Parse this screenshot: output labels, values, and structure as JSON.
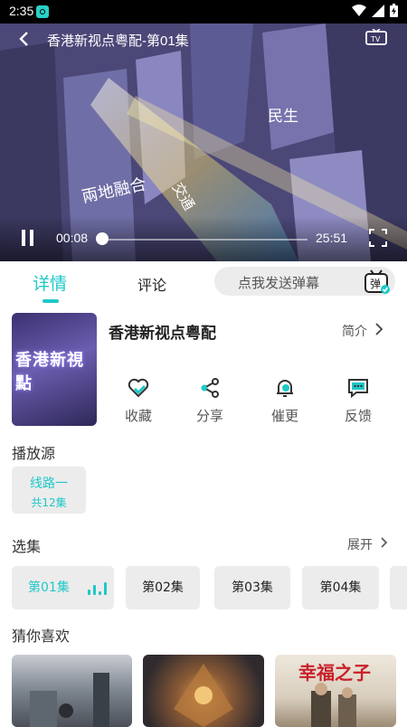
{
  "status_bar": {
    "time": "2:35"
  },
  "player": {
    "title": "香港新视点粤配-第01集",
    "current_time": "00:08",
    "duration": "25:51",
    "progress": 0.005,
    "overlay_texts": [
      "兩地融合",
      "交通",
      "民生"
    ]
  },
  "tabs": {
    "details": "详情",
    "comments": "评论"
  },
  "danmu": {
    "placeholder": "点我发送弹幕",
    "icon_label": "弹"
  },
  "show": {
    "title": "香港新视点粤配",
    "cover_text": "香港新視點",
    "intro_label": "简介"
  },
  "actions": [
    {
      "label": "收藏",
      "icon": "heart-icon"
    },
    {
      "label": "分享",
      "icon": "share-icon"
    },
    {
      "label": "催更",
      "icon": "bell-icon"
    },
    {
      "label": "反馈",
      "icon": "feedback-icon"
    }
  ],
  "sources": {
    "title": "播放源",
    "items": [
      {
        "name": "线路一",
        "count": "共12集"
      }
    ]
  },
  "episodes": {
    "title": "选集",
    "expand_label": "展开",
    "items": [
      "第01集",
      "第02集",
      "第03集",
      "第04集"
    ],
    "selected_index": 0
  },
  "recommend": {
    "title": "猜你喜欢",
    "thumb3_text": "幸福之子"
  },
  "colors": {
    "accent": "#1fc8c8",
    "chip_bg": "#ececec"
  }
}
